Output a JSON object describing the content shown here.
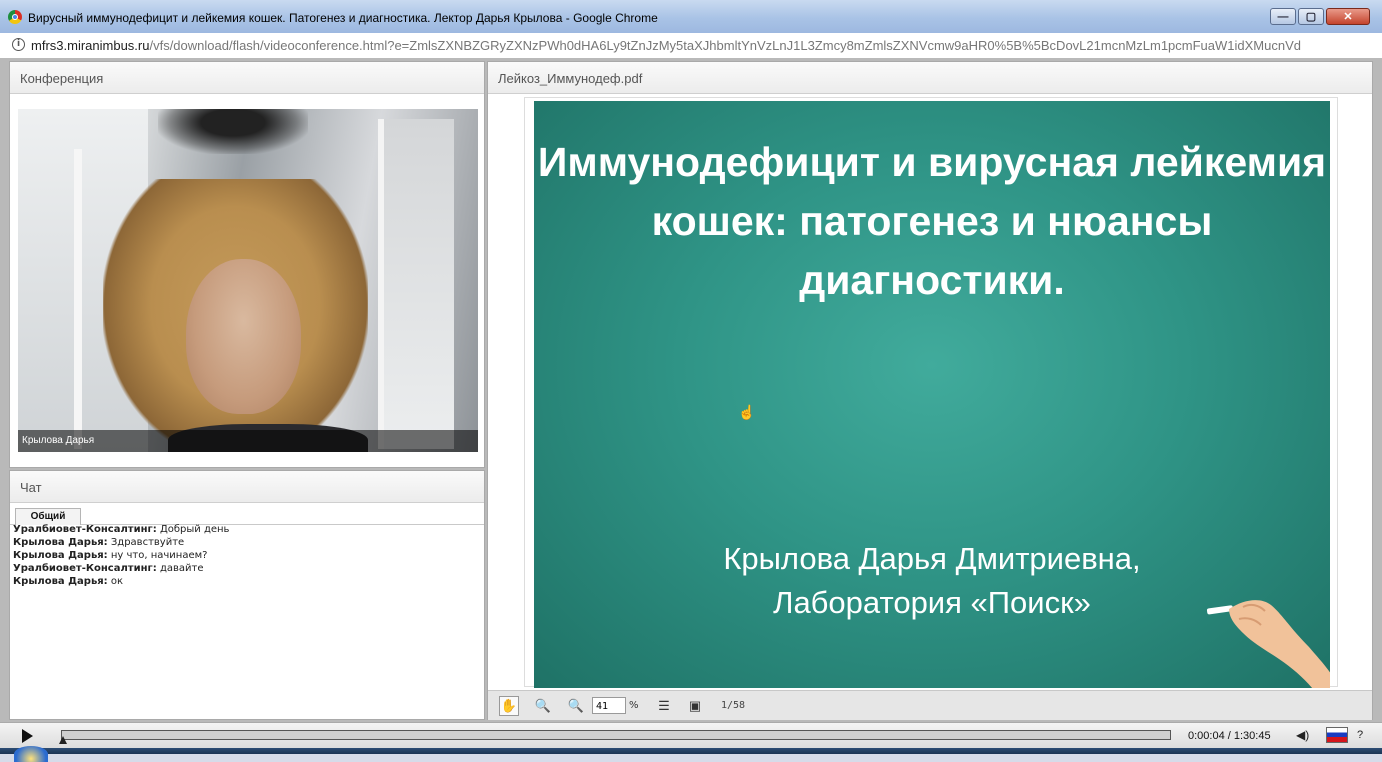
{
  "window": {
    "title": "Вирусный иммунодефицит и лейкемия кошек. Патогенез и диагностика. Лектор Дарья Крылова - Google Chrome",
    "minimize": "—",
    "maximize": "▢",
    "close": "✕"
  },
  "address": {
    "host": "mfrs3.miranimbus.ru",
    "path": "/vfs/download/flash/videoconference.html?e=ZmlsZXNBZGRyZXNzPWh0dHA6Ly9tZnJzMy5taXJhbmltYnVzLnJ1L3Zmcy8mZmlsZXNVcmw9aHR0%5B%5BcDovL21mcnMzLm1pcmFuaW1idXMucnVd"
  },
  "conference": {
    "header": "Конференция",
    "participant_name": "Крылова Дарья"
  },
  "chat": {
    "header": "Чат",
    "tab": "Общий",
    "messages": [
      {
        "author": "Уралбиовет-Консалтинг:",
        "text": "Добрый день"
      },
      {
        "author": "Крылова Дарья:",
        "text": "Здравствуйте"
      },
      {
        "author": "Крылова Дарья:",
        "text": "ну что, начинаем?"
      },
      {
        "author": "Уралбиовет-Консалтинг:",
        "text": "давайте"
      },
      {
        "author": "Крылова Дарья:",
        "text": "ок"
      }
    ]
  },
  "presentation": {
    "file_name": "Лейкоз_Иммунодеф.pdf",
    "slide_title": "Иммунодефицит и вирусная лейкемия кошек: патогенез и нюансы диагностики.",
    "slide_author_line1": "Крылова Дарья Дмитриевна,",
    "slide_author_line2": "Лаборатория «Поиск»",
    "zoom": "41",
    "zoom_unit": "%",
    "page": "1/58"
  },
  "player": {
    "time": "0:00:04 / 1:30:45",
    "help": "?"
  },
  "colors": {
    "slide_bg": "#2f9486",
    "panel_header_text": "#555555"
  }
}
